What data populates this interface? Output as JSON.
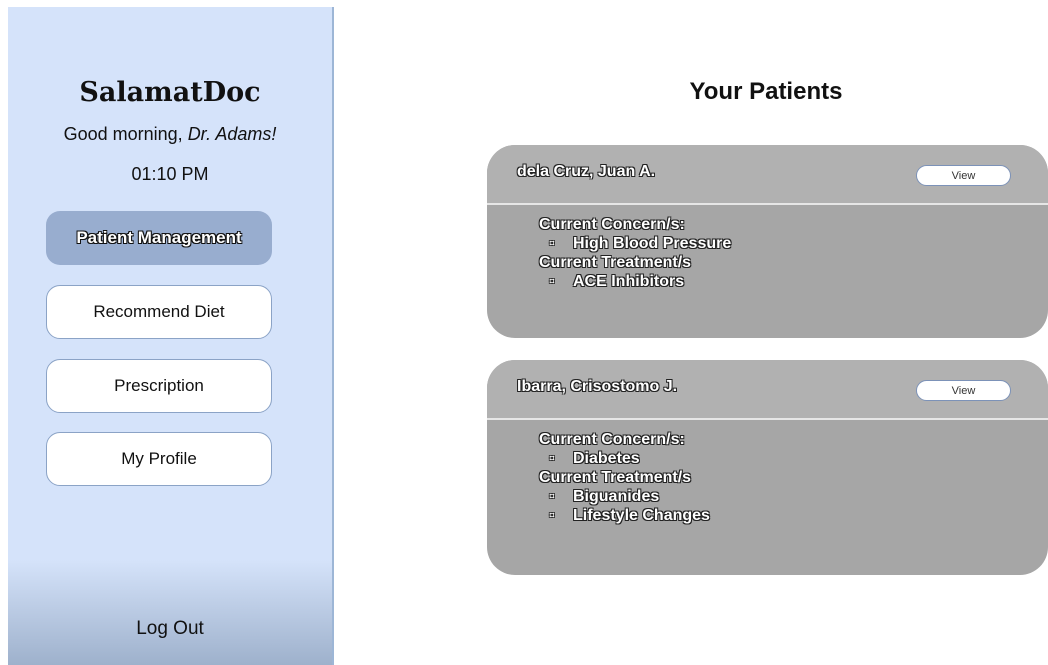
{
  "sidebar": {
    "brand": "SalamatDoc",
    "greeting_prefix": "Good morning, ",
    "greeting_name": "Dr. Adams!",
    "time": "01:10 PM",
    "nav": [
      {
        "label": "Patient Management",
        "active": true
      },
      {
        "label": "Recommend Diet",
        "active": false
      },
      {
        "label": "Prescription",
        "active": false
      },
      {
        "label": "My Profile",
        "active": false
      }
    ],
    "logout_label": "Log Out"
  },
  "main": {
    "title": "Your Patients",
    "patients": [
      {
        "name": "dela Cruz, Juan A.",
        "view_label": "View",
        "concerns_label": "Current Concern/s:",
        "concerns": [
          "High Blood Pressure"
        ],
        "treatments_label": "Current Treatment/s",
        "treatments": [
          "ACE Inhibitors"
        ]
      },
      {
        "name": "Ibarra, Crisostomo J.",
        "view_label": "View",
        "concerns_label": "Current Concern/s:",
        "concerns": [
          "Diabetes"
        ],
        "treatments_label": "Current Treatment/s",
        "treatments": [
          "Biguanides",
          "Lifestyle Changes"
        ]
      }
    ]
  },
  "colors": {
    "sidebar_bg": "#d5e3fa",
    "active_nav": "#98adcf",
    "card_bg": "#a6a6a6"
  }
}
